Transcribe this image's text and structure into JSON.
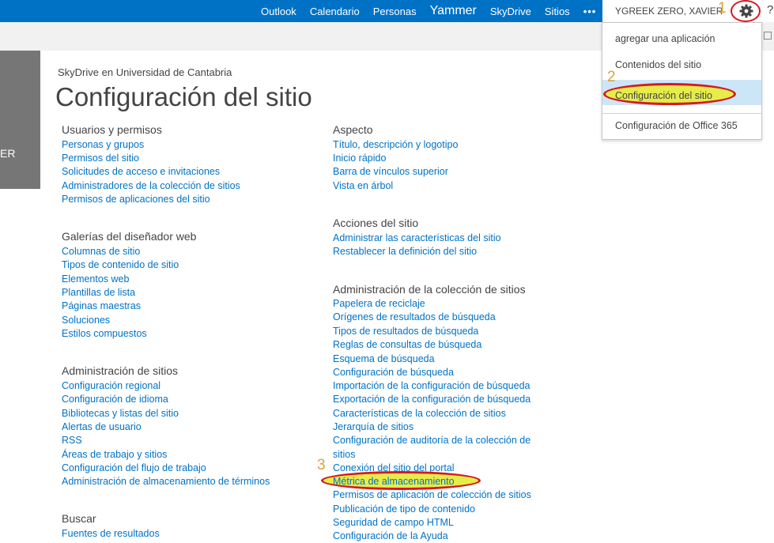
{
  "suite_nav": {
    "links": [
      "Outlook",
      "Calendario",
      "Personas",
      "Yammer",
      "SkyDrive",
      "Sitios",
      "•••"
    ],
    "user_name": "YGREEK ZERO, XAVIER",
    "help": "?"
  },
  "left_panel": {
    "label": "ER"
  },
  "breadcrumb": "SkyDrive en Universidad de Cantabria",
  "page_title": "Configuración del sitio",
  "settings_menu": {
    "items": [
      "agregar una aplicación",
      "Contenidos del sitio",
      "Configuración del sitio",
      "Configuración de Office 365"
    ],
    "selected": "Configuración del sitio"
  },
  "annotations": {
    "step1": "1",
    "step2": "2",
    "step3": "3"
  },
  "sections": {
    "usuarios": {
      "heading": "Usuarios y permisos",
      "links": [
        "Personas y grupos",
        "Permisos del sitio",
        "Solicitudes de acceso e invitaciones",
        "Administradores de la colección de sitios",
        "Permisos de aplicaciones del sitio"
      ]
    },
    "galerias": {
      "heading": "Galerías del diseñador web",
      "links": [
        "Columnas de sitio",
        "Tipos de contenido de sitio",
        "Elementos web",
        "Plantillas de lista",
        "Páginas maestras",
        "Soluciones",
        "Estilos compuestos"
      ]
    },
    "admin_sitios": {
      "heading": "Administración de sitios",
      "links": [
        "Configuración regional",
        "Configuración de idioma",
        "Bibliotecas y listas del sitio",
        "Alertas de usuario",
        "RSS",
        "Áreas de trabajo y sitios",
        "Configuración del flujo de trabajo",
        "Administración de almacenamiento de términos"
      ]
    },
    "buscar": {
      "heading": "Buscar",
      "links": [
        "Fuentes de resultados"
      ]
    },
    "aspecto": {
      "heading": "Aspecto",
      "links": [
        "Título, descripción y logotipo",
        "Inicio rápido",
        "Barra de vínculos superior",
        "Vista en árbol"
      ]
    },
    "acciones": {
      "heading": "Acciones del sitio",
      "links": [
        "Administrar las características del sitio",
        "Restablecer la definición del sitio"
      ]
    },
    "coleccion": {
      "heading": "Administración de la colección de sitios",
      "links": [
        "Papelera de reciclaje",
        "Orígenes de resultados de búsqueda",
        "Tipos de resultados de búsqueda",
        "Reglas de consultas de búsqueda",
        "Esquema de búsqueda",
        "Configuración de búsqueda",
        "Importación de la configuración de búsqueda",
        "Exportación de la configuración de búsqueda",
        "Características de la colección de sitios",
        "Jerarquía de sitios",
        "Configuración de auditoría de la colección de",
        "sitios",
        "Conexión del sitio del portal",
        "Métrica de almacenamiento",
        "Permisos de aplicación de colección de sitios",
        "Publicación de tipo de contenido",
        "Seguridad de campo HTML",
        "Configuración de la Ayuda"
      ]
    }
  },
  "colors": {
    "suite_bar": "#0072c6",
    "link": "#0072c6",
    "highlight": "#e6ec4a",
    "annotation_ring": "#d6181e",
    "annotation_number": "#d9a43a"
  }
}
